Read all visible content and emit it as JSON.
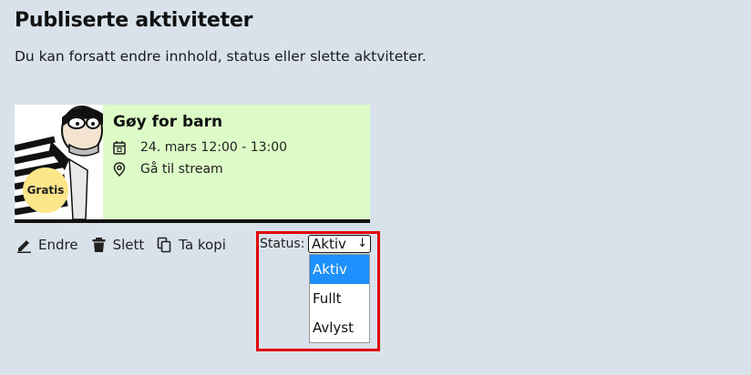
{
  "page": {
    "title": "Publiserte aktiviteter",
    "subtitle": "Du kan forsatt endre innhold, status eller slette aktviteter."
  },
  "card": {
    "badge": "Gratis",
    "title": "Gøy for barn",
    "date": "24. mars 12:00 - 13:00",
    "location": "Gå til stream",
    "icons": {
      "date": "calendar-icon",
      "location": "map-pin-icon"
    },
    "colors": {
      "background": "#dcfbc6",
      "badge": "#fde68a"
    }
  },
  "actions": [
    {
      "label": "Endre",
      "icon": "pencil-icon"
    },
    {
      "label": "Slett",
      "icon": "trash-icon"
    },
    {
      "label": "Ta kopi",
      "icon": "copy-icon"
    }
  ],
  "status": {
    "label": "Status:",
    "selected": "Aktiv",
    "options": [
      "Aktiv",
      "Fullt",
      "Avlyst"
    ]
  },
  "colors": {
    "page_background": "#d9e2eb",
    "highlight_border": "#e00000",
    "selected_option": "#1e90ff"
  }
}
